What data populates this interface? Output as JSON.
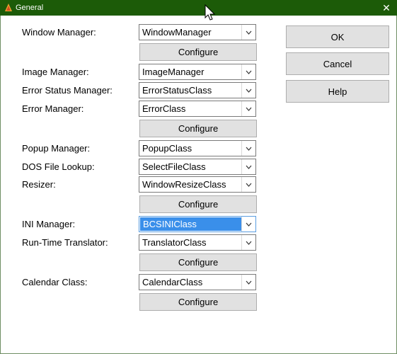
{
  "window": {
    "title": "General",
    "close_glyph": "✕"
  },
  "fields": [
    {
      "label": "Window Manager:",
      "value": "WindowManager"
    },
    {
      "label": "Image Manager:",
      "value": "ImageManager"
    },
    {
      "label": "Error Status Manager:",
      "value": "ErrorStatusClass"
    },
    {
      "label": "Error Manager:",
      "value": "ErrorClass"
    },
    {
      "label": "Popup Manager:",
      "value": "PopupClass"
    },
    {
      "label": "DOS File Lookup:",
      "value": "SelectFileClass"
    },
    {
      "label": "Resizer:",
      "value": "WindowResizeClass"
    },
    {
      "label": "INI Manager:",
      "value": "BCSINIClass",
      "selected": true
    },
    {
      "label": "Run-Time Translator:",
      "value": "TranslatorClass"
    },
    {
      "label": "Calendar Class:",
      "value": "CalendarClass"
    }
  ],
  "configure_label": "Configure",
  "buttons": {
    "ok": "OK",
    "cancel": "Cancel",
    "help": "Help"
  },
  "colors": {
    "titlebar": "#1c5b08",
    "selection": "#3a8fea",
    "button_face": "#e1e1e1"
  },
  "icons": [
    "app-icon",
    "close-icon",
    "chevron-down-icon",
    "mouse-cursor-icon"
  ]
}
